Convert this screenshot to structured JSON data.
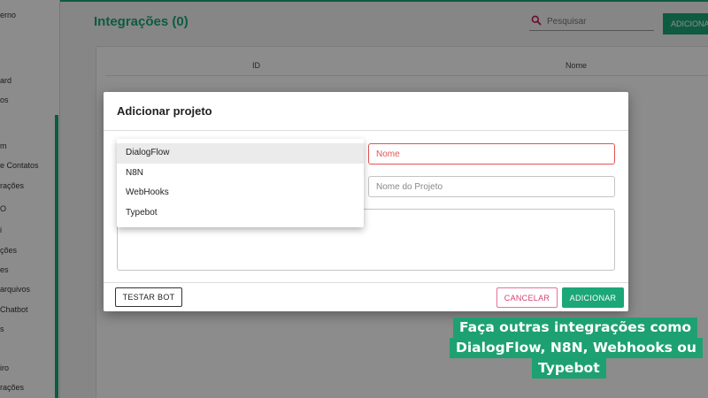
{
  "sidebar": {
    "items": [
      {
        "label": "erno"
      },
      {
        "label": "ard"
      },
      {
        "label": "os"
      },
      {
        "label": "m"
      },
      {
        "label": "e Contatos"
      },
      {
        "label": "rações"
      },
      {
        "label": "O"
      },
      {
        "label": "i"
      },
      {
        "label": "ções"
      },
      {
        "label": "es"
      },
      {
        "label": "arquivos"
      },
      {
        "label": "Chatbot"
      },
      {
        "label": "s"
      },
      {
        "label": "iro"
      },
      {
        "label": "rações"
      }
    ]
  },
  "header": {
    "title": "Integrações (0)",
    "search_placeholder": "Pesquisar",
    "add_label": "ADICIONAR"
  },
  "table": {
    "columns": [
      "ID",
      "Nome"
    ]
  },
  "dialog": {
    "title": "Adicionar projeto",
    "dropdown_options": [
      "DialogFlow",
      "N8N",
      "WebHooks",
      "Typebot"
    ],
    "selected_option": "DialogFlow",
    "name_placeholder": "Nome",
    "project_placeholder": "Nome do Projeto",
    "description_value": "",
    "test_label": "TESTAR BOT",
    "cancel_label": "CANCELAR",
    "add_label": "ADICIONAR"
  },
  "caption": {
    "lines": [
      "Faça outras integrações como",
      "DialogFlow, N8N, Webhooks ou",
      "Typebot"
    ]
  },
  "colors": {
    "accent": "#1ba777",
    "error": "#e55353",
    "cancel": "#d43f74",
    "caption_bg": "#1ea172"
  }
}
